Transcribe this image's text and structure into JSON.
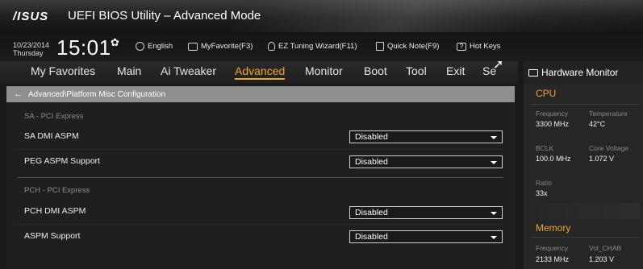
{
  "title": {
    "logo": "/ISUS",
    "app_title": "UEFI BIOS Utility – Advanced Mode"
  },
  "infobar": {
    "date": "10/23/2014",
    "day": "Thursday",
    "time": "15:01",
    "items": [
      {
        "label": "English",
        "icon": "globe-icon"
      },
      {
        "label": "MyFavorite(F3)",
        "icon": "favorite-icon"
      },
      {
        "label": "EZ Tuning Wizard(F11)",
        "icon": "bulb-icon"
      },
      {
        "label": "Quick Note(F9)",
        "icon": "note-icon"
      },
      {
        "label": "Hot Keys",
        "icon": "hotkeys-icon",
        "icon_text": "?"
      }
    ]
  },
  "tabs": [
    "My Favorites",
    "Main",
    "Ai Tweaker",
    "Advanced",
    "Monitor",
    "Boot",
    "Tool",
    "Exit",
    "Se"
  ],
  "active_tab": "Advanced",
  "breadcrumb": "Advanced\\Platform Misc Configuration",
  "sections": {
    "sa": "SA - PCI Express",
    "pch": "PCH - PCI Express"
  },
  "settings": [
    {
      "label": "SA DMI ASPM",
      "value": "Disabled"
    },
    {
      "label": "PEG ASPM Support",
      "value": "Disabled"
    },
    {
      "label": "PCH DMI ASPM",
      "value": "Disabled"
    },
    {
      "label": "ASPM Support",
      "value": "Disabled"
    }
  ],
  "hw_monitor": {
    "title": "Hardware Monitor",
    "cpu": {
      "title": "CPU",
      "frequency_label": "Frequency",
      "frequency": "3300 MHz",
      "temperature_label": "Temperature",
      "temperature": "42°C",
      "bclk_label": "BCLK",
      "bclk": "100.0 MHz",
      "core_voltage_label": "Core Voltage",
      "core_voltage": "1.072 V",
      "ratio_label": "Ratio",
      "ratio": "33x"
    },
    "memory": {
      "title": "Memory",
      "frequency_label": "Frequency",
      "frequency": "2133 MHz",
      "vol_label": "Vol_CHAB",
      "vol": "1.203 V"
    }
  },
  "colors": {
    "accent": "#f2a52b",
    "breadcrumb_bg": "#8f8f8f"
  }
}
